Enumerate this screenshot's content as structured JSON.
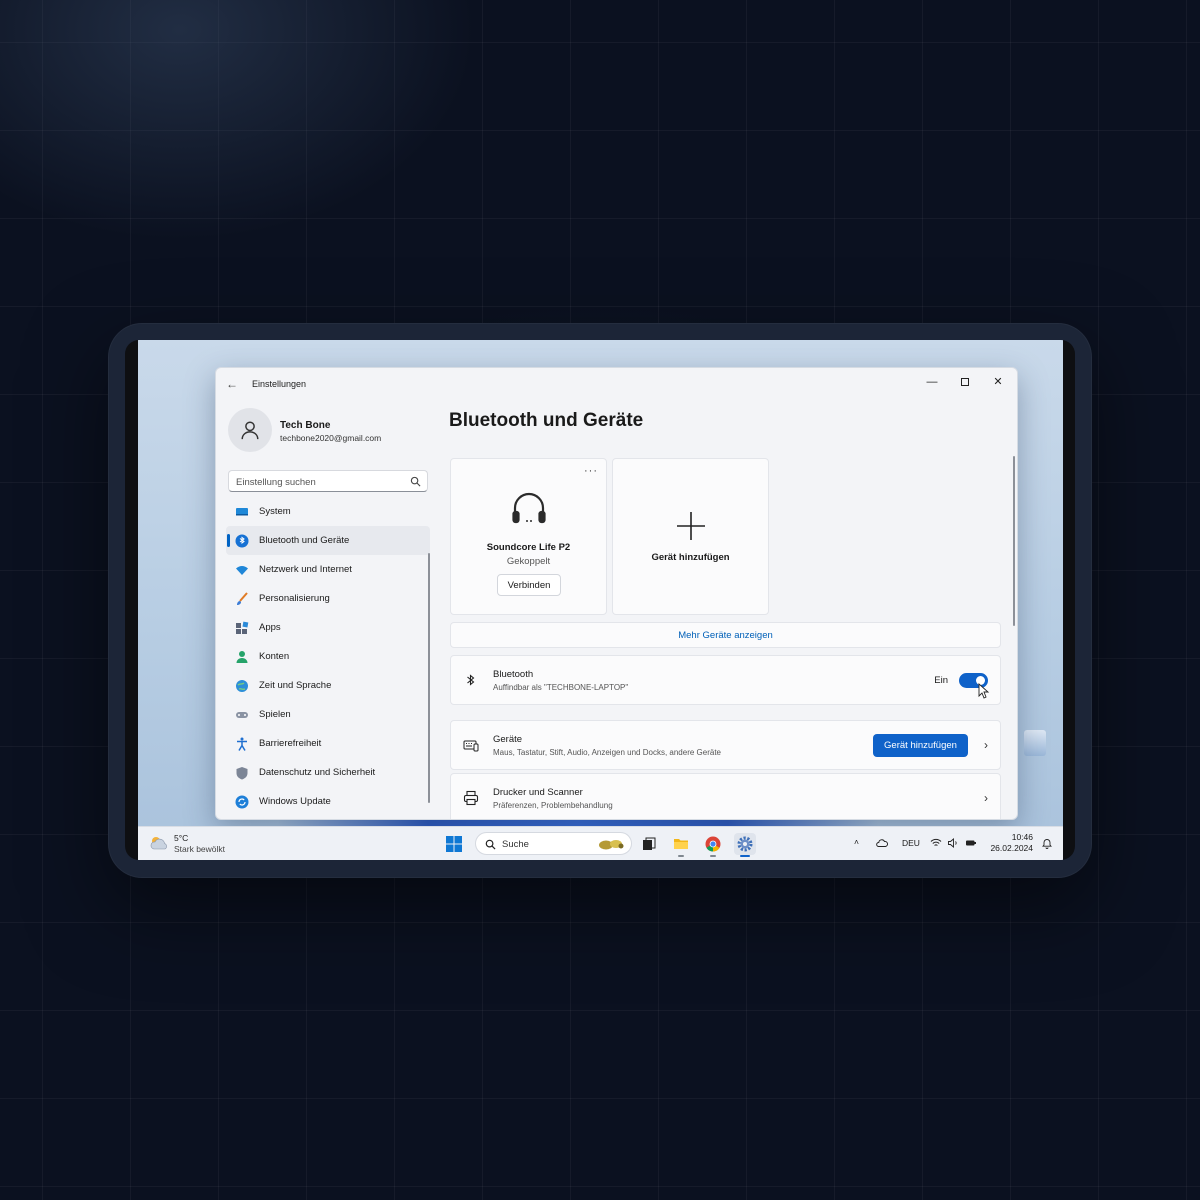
{
  "window": {
    "title": "Einstellungen",
    "minimize_glyph": "—",
    "close_glyph": "✕",
    "back_glyph": "←"
  },
  "profile": {
    "name": "Tech Bone",
    "email": "techbone2020@gmail.com"
  },
  "search": {
    "placeholder": "Einstellung suchen"
  },
  "nav": {
    "items": [
      {
        "label": "System",
        "icon": "monitor-icon"
      },
      {
        "label": "Bluetooth und Geräte",
        "icon": "bluetooth-icon",
        "active": true
      },
      {
        "label": "Netzwerk und Internet",
        "icon": "wifi-icon"
      },
      {
        "label": "Personalisierung",
        "icon": "brush-icon"
      },
      {
        "label": "Apps",
        "icon": "apps-icon"
      },
      {
        "label": "Konten",
        "icon": "person-icon"
      },
      {
        "label": "Zeit und Sprache",
        "icon": "globe-clock-icon"
      },
      {
        "label": "Spielen",
        "icon": "gamepad-icon"
      },
      {
        "label": "Barrierefreiheit",
        "icon": "accessibility-icon"
      },
      {
        "label": "Datenschutz und Sicherheit",
        "icon": "shield-icon"
      },
      {
        "label": "Windows Update",
        "icon": "update-icon"
      }
    ]
  },
  "main": {
    "title": "Bluetooth und Geräte",
    "device_tile": {
      "more": "···",
      "name": "Soundcore Life P2",
      "status": "Gekoppelt",
      "button": "Verbinden"
    },
    "add_tile": {
      "label": "Gerät hinzufügen"
    },
    "more_devices": "Mehr Geräte anzeigen",
    "bluetooth_row": {
      "title": "Bluetooth",
      "subtitle": "Auffindbar als \"TECHBONE-LAPTOP\"",
      "toggle_label": "Ein",
      "toggle_on": true
    },
    "devices_row": {
      "title": "Geräte",
      "subtitle": "Maus, Tastatur, Stift, Audio, Anzeigen und Docks, andere Geräte",
      "button": "Gerät hinzufügen",
      "chevron": "›"
    },
    "printer_row": {
      "title": "Drucker und Scanner",
      "subtitle": "Präferenzen, Problembehandlung",
      "chevron": "›"
    }
  },
  "taskbar": {
    "weather_temp": "5°C",
    "weather_condition": "Stark bewölkt",
    "search_placeholder": "Suche",
    "chevron_up": "˄",
    "language": "DEU",
    "time": "10:46",
    "date": "26.02.2024"
  },
  "colors": {
    "accent": "#0f62c9",
    "link": "#0060b8"
  }
}
